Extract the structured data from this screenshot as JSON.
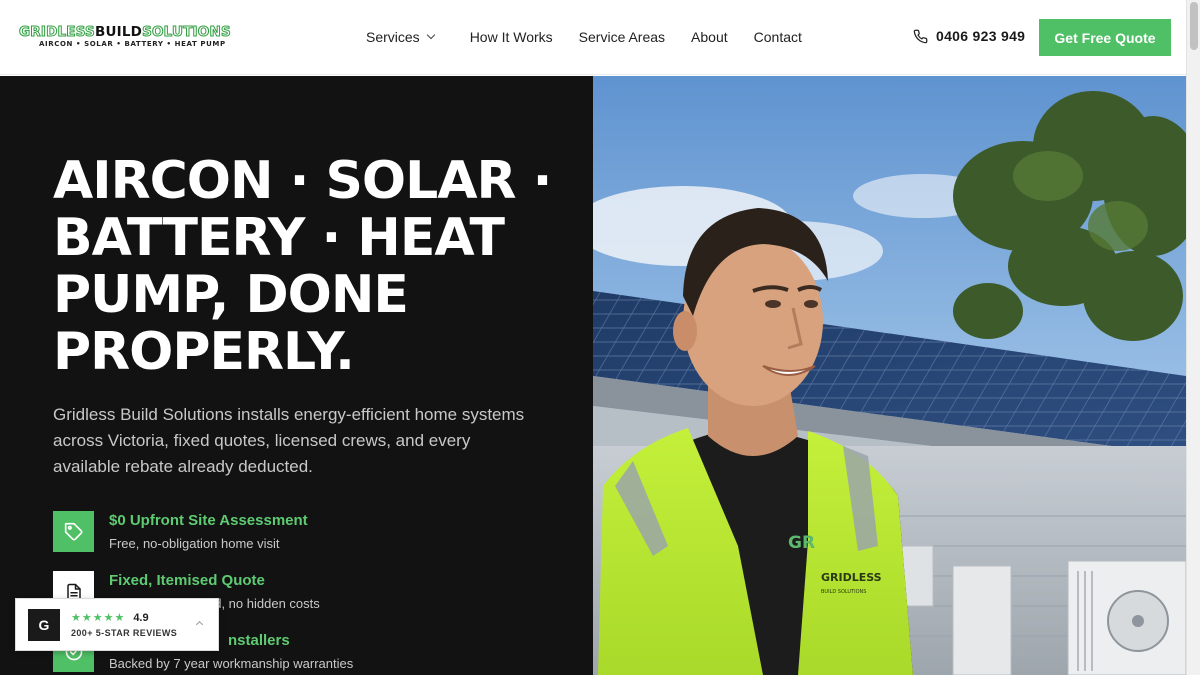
{
  "header": {
    "logo_prefix": "GRIDLESS",
    "logo_middle": "BUILD",
    "logo_suffix": "SOLUTIONS",
    "logo_tagline": "AIRCON • SOLAR • BATTERY • HEAT PUMP",
    "nav": [
      {
        "label": "Services",
        "has_dropdown": true
      },
      {
        "label": "How It Works"
      },
      {
        "label": "Service Areas"
      },
      {
        "label": "About"
      },
      {
        "label": "Contact"
      }
    ],
    "phone_icon": "phone-icon",
    "phone": "0406 923 949",
    "cta_label": "Get Free Quote"
  },
  "hero": {
    "title": "AIRCON · SOLAR · BATTERY · HEAT PUMP, DONE PROPERLY.",
    "description": "Gridless Build Solutions installs energy-efficient home systems across Victoria, fixed quotes, licensed crews, and every available rebate already deducted.",
    "features": [
      {
        "icon": "tag-icon",
        "title": "$0 Upfront Site Assessment",
        "subtitle": "Free, no-obligation home visit"
      },
      {
        "icon": "document-icon",
        "title": "Fixed, Itemised Quote",
        "subtitle": "ed, no hidden costs"
      },
      {
        "icon": "check-circle-icon",
        "title": "nstallers",
        "subtitle": "Backed by 7 year workmanship warranties"
      }
    ]
  },
  "reviews": {
    "badge": "G",
    "stars": "★★★★★",
    "rating": "4.9",
    "count_label": "200+ 5-STAR REVIEWS"
  },
  "photo": {
    "vest_text_1": "GRIDLESS",
    "vest_text_2": "BUILD SOLUTIONS",
    "shirt_text": "GR"
  },
  "colors": {
    "accent": "#4fc065",
    "hero_bg": "#121212",
    "feature_title": "#5ecb72"
  }
}
